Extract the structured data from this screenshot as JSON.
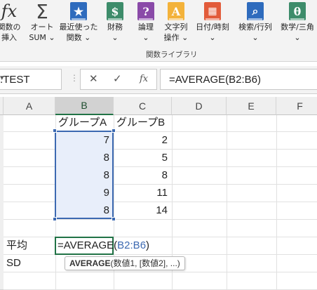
{
  "ribbon": {
    "buttons": [
      {
        "id": "insert_function",
        "icon_glyph": "fx",
        "line1": "関数の",
        "line2": "挿入"
      },
      {
        "id": "autosum",
        "icon_glyph": "Σ",
        "line1": "オート",
        "line2": "SUM ⌄"
      },
      {
        "id": "recent",
        "icon_glyph": "★",
        "line1": "最近使った",
        "line2": "関数 ⌄"
      },
      {
        "id": "financial",
        "icon_glyph": "$",
        "line1": "財務",
        "line2": "⌄"
      },
      {
        "id": "logical",
        "icon_glyph": "?",
        "line1": "論理",
        "line2": "⌄"
      },
      {
        "id": "text",
        "icon_glyph": "A",
        "line1": "文字列",
        "line2": "操作 ⌄"
      },
      {
        "id": "datetime",
        "icon_glyph": "▦",
        "line1": "日付/時刻",
        "line2": "⌄"
      },
      {
        "id": "lookup",
        "icon_glyph": "⌕",
        "line1": "検索/行列",
        "line2": "⌄"
      },
      {
        "id": "math",
        "icon_glyph": "θ",
        "line1": "数学/三角",
        "line2": "⌄"
      }
    ],
    "group_label": "関数ライブラリ",
    "colors": {
      "recent": "#2e6bbd",
      "financial": "#3d8c6a",
      "logical": "#8a4aa8",
      "text": "#f3b23a",
      "datetime": "#e25b3a",
      "lookup": "#2e6bbd",
      "math": "#3d8c6a"
    }
  },
  "formula_bar": {
    "name_box": ".TEST",
    "cancel_glyph": "✕",
    "enter_glyph": "✓",
    "fx_glyph": "fx",
    "formula": "=AVERAGE(B2:B6)"
  },
  "grid": {
    "columns": [
      "A",
      "B",
      "C",
      "D",
      "E",
      "F"
    ],
    "selected_column": "B",
    "headers": {
      "B1": "グループA",
      "C1": "グループB"
    },
    "group_a": [
      "7",
      "8",
      "8",
      "9",
      "8"
    ],
    "group_b": [
      "2",
      "5",
      "8",
      "11",
      "14"
    ],
    "row_labels": {
      "A8": "平均",
      "A9": "SD"
    },
    "editing": {
      "prefix": "=AVERAGE(",
      "ref": "B2:B6",
      "suffix": ")"
    },
    "tooltip": {
      "func": "AVERAGE",
      "args": "(数値1, [数値2], ...)"
    }
  }
}
